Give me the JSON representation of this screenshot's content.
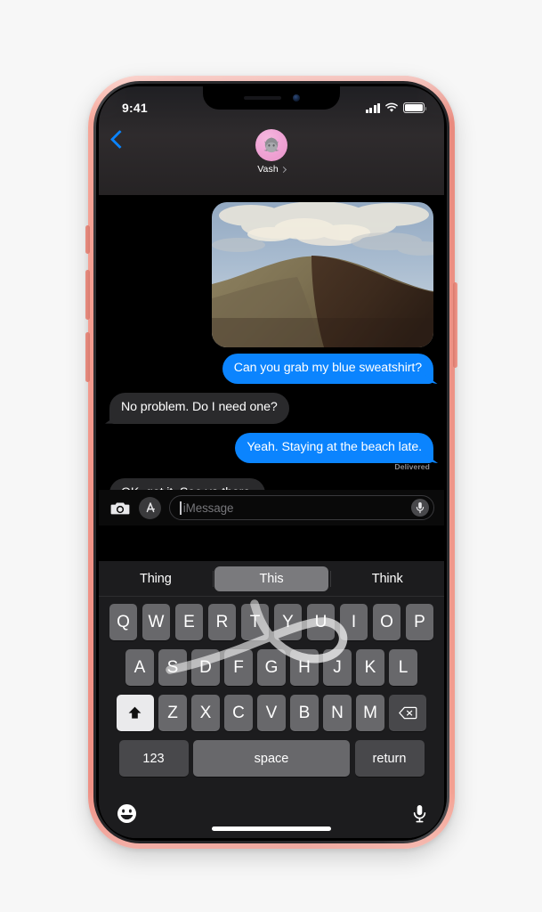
{
  "device": {
    "model_color": "coral",
    "band_color": "#ec8a7e",
    "hardware_buttons": [
      "ring-switch",
      "volume-up",
      "volume-down",
      "power"
    ]
  },
  "status_bar": {
    "time": "9:41",
    "signal_icon": "cellular-bars-icon",
    "signal_bars": 4,
    "wifi_icon": "wifi-icon",
    "battery_icon": "battery-full-icon",
    "battery_level": 100
  },
  "header": {
    "back_icon": "back-chevron-icon",
    "avatar_icon": "memoji-avatar",
    "avatar_bg": "#f0a5d6",
    "contact_name": "Vash",
    "detail_chevron_icon": "chevron-right-icon"
  },
  "conversation": {
    "messages": [
      {
        "type": "photo",
        "side": "out",
        "alt": "hill-landscape-photo"
      },
      {
        "type": "text",
        "side": "out",
        "text": "Can you grab my blue sweatshirt?"
      },
      {
        "type": "text",
        "side": "in",
        "text": "No problem. Do I need one?"
      },
      {
        "type": "text",
        "side": "out",
        "text": "Yeah. Staying at the beach late."
      },
      {
        "type": "status",
        "side": "out",
        "text": "Delivered"
      },
      {
        "type": "text",
        "side": "in",
        "text": "OK, got it. See ya there."
      }
    ],
    "bubble_out_color": "#0b84fe",
    "bubble_in_color": "#2a2a2c"
  },
  "input_bar": {
    "camera_icon": "camera-icon",
    "appstore_icon": "app-store-icon",
    "placeholder": "iMessage",
    "value": "",
    "mic_icon": "microphone-icon"
  },
  "keyboard": {
    "predictions": [
      {
        "label": "Thing",
        "selected": false
      },
      {
        "label": "This",
        "selected": true
      },
      {
        "label": "Think",
        "selected": false
      }
    ],
    "row1": [
      "Q",
      "W",
      "E",
      "R",
      "T",
      "Y",
      "U",
      "I",
      "O",
      "P"
    ],
    "row2": [
      "A",
      "S",
      "D",
      "F",
      "G",
      "H",
      "J",
      "K",
      "L"
    ],
    "row3": [
      "Z",
      "X",
      "C",
      "V",
      "B",
      "N",
      "M"
    ],
    "shift_icon": "shift-arrow-icon",
    "shift_active": true,
    "backspace_icon": "backspace-icon",
    "numbers_label": "123",
    "space_label": "space",
    "return_label": "return",
    "swipe_trail": {
      "active": true,
      "word": "This",
      "path_keys": [
        "T",
        "H",
        "I",
        "S"
      ],
      "color": "#d8d8d8"
    }
  },
  "bottom_bar": {
    "emoji_icon": "emoji-smiley-icon",
    "dictation_icon": "microphone-icon",
    "home_indicator": "home-indicator"
  }
}
